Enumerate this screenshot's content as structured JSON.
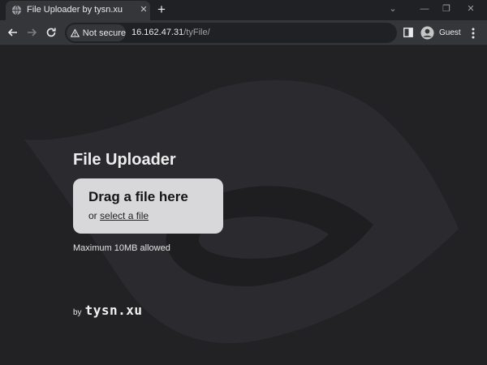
{
  "browser": {
    "tab_title": "File Uploader by tysn.xu",
    "security_label": "Not secure",
    "url_host": "16.162.47.31",
    "url_path": "/tyFile/",
    "profile_name": "Guest"
  },
  "page": {
    "heading": "File Uploader",
    "dropzone_title": "Drag a file here",
    "dropzone_or": "or",
    "dropzone_link": "select a file",
    "max_note": "Maximum 10MB allowed",
    "credit_by": "by",
    "credit_brand": "tysn.xu"
  },
  "colors": {
    "page_bg": "#222124",
    "dropzone_bg": "#d8d7da",
    "chrome_bg": "#35363a"
  }
}
